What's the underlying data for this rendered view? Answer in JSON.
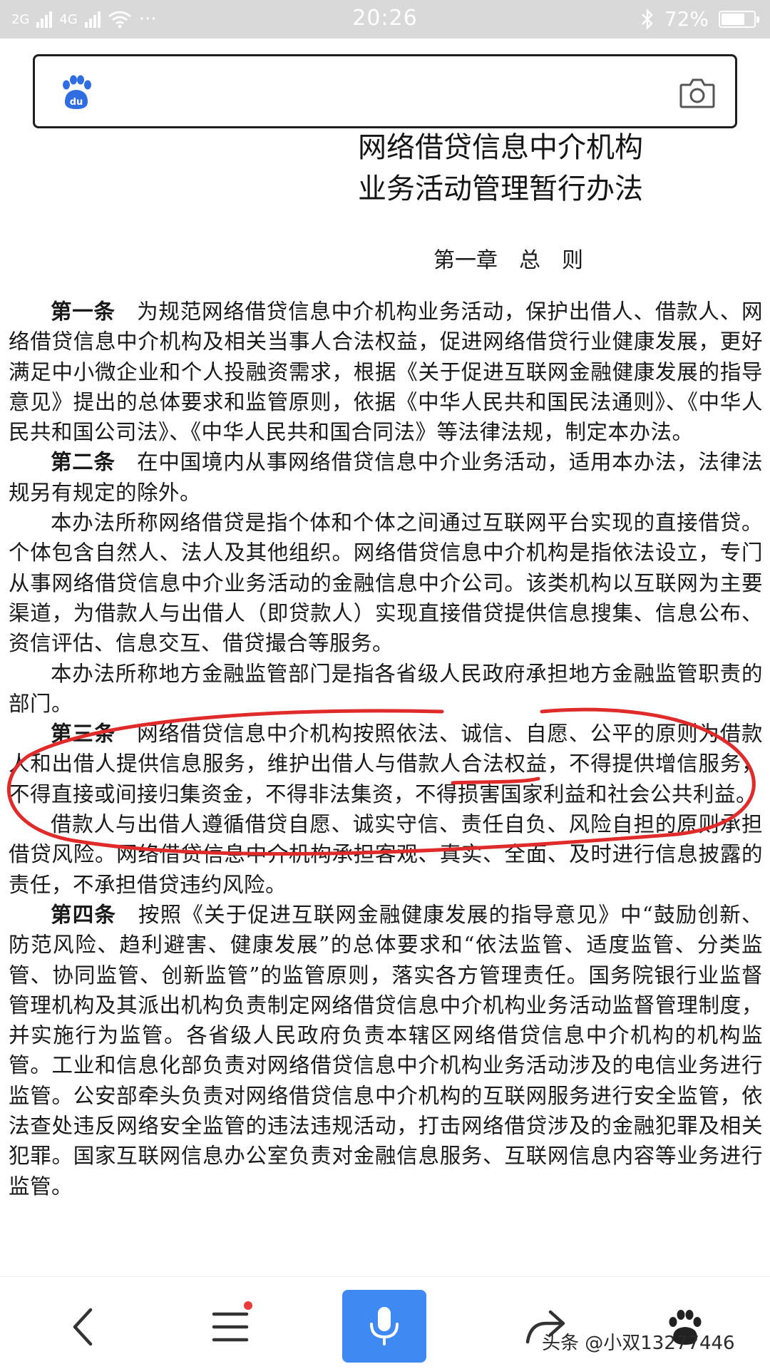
{
  "status_bar": {
    "network_1": "2G",
    "network_2": "4G",
    "more": "···",
    "time": "20:26",
    "battery": "72%",
    "battery_level": 0.72
  },
  "document": {
    "title_line1": "网络借贷信息中介机构",
    "title_line2": "业务活动管理暂行办法",
    "chapter": "第一章　总　则",
    "paragraphs": [
      {
        "article": "第一条",
        "text": "　为规范网络借贷信息中介机构业务活动，保护出借人、借款人、网络借贷信息中介机构及相关当事人合法权益，促进网络借贷行业健康发展，更好满足中小微企业和个人投融资需求，根据《关于促进互联网金融健康发展的指导意见》提出的总体要求和监管原则，依据《中华人民共和国民法通则》、《中华人民共和国公司法》、《中华人民共和国合同法》等法律法规，制定本办法。"
      },
      {
        "article": "第二条",
        "text": "　在中国境内从事网络借贷信息中介业务活动，适用本办法，法律法规另有规定的除外。"
      },
      {
        "article": "",
        "text": "本办法所称网络借贷是指个体和个体之间通过互联网平台实现的直接借贷。个体包含自然人、法人及其他组织。网络借贷信息中介机构是指依法设立，专门从事网络借贷信息中介业务活动的金融信息中介公司。该类机构以互联网为主要渠道，为借款人与出借人（即贷款人）实现直接借贷提供信息搜集、信息公布、资信评估、信息交互、借贷撮合等服务。"
      },
      {
        "article": "",
        "text": "本办法所称地方金融监管部门是指各省级人民政府承担地方金融监管职责的部门。"
      },
      {
        "article": "第三条",
        "text": "　网络借贷信息中介机构按照依法、诚信、自愿、公平的原则为借款人和出借人提供信息服务，维护出借人与借款人合法权益，不得提供增信服务，不得直接或间接归集资金，不得非法集资，不得损害国家利益和社会公共利益。"
      },
      {
        "article": "",
        "text": "借款人与出借人遵循借贷自愿、诚实守信、责任自负、风险自担的原则承担借贷风险。网络借贷信息中介机构承担客观、真实、全面、及时进行信息披露的责任，不承担借贷违约风险。"
      },
      {
        "article": "第四条",
        "text": "　按照《关于促进互联网金融健康发展的指导意见》中“鼓励创新、防范风险、趋利避害、健康发展”的总体要求和“依法监管、适度监管、分类监管、协同监管、创新监管”的监管原则，落实各方管理责任。国务院银行业监督管理机构及其派出机构负责制定网络借贷信息中介机构业务活动监督管理制度，并实施行为监管。各省级人民政府负责本辖区网络借贷信息中介机构的机构监管。工业和信息化部负责对网络借贷信息中介机构业务活动涉及的电信业务进行监管。公安部牵头负责对网络借贷信息中介机构的互联网服务进行安全监管，依法查处违反网络安全监管的违法违规活动，打击网络借贷涉及的金融犯罪及相关犯罪。国家互联网信息办公室负责对金融信息服务、互联网信息内容等业务进行监管。"
      }
    ]
  },
  "bottom_nav": {
    "watermark": "头条 @小双13277446"
  },
  "colors": {
    "status_bar_bg": "#d9d9d9",
    "voice_button": "#3e8af2",
    "baidu_blue": "#2f6de0",
    "annotation_red": "#e02b2b",
    "badge_red": "#e83c3c"
  },
  "icons": [
    "baidu-paw-icon",
    "camera-icon",
    "back-icon",
    "menu-icon",
    "microphone-icon",
    "share-icon",
    "paw-icon"
  ]
}
